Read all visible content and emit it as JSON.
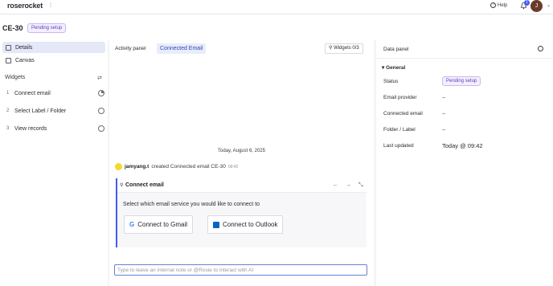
{
  "app": {
    "logo": "roserocket"
  },
  "topbar": {
    "help_label": "Help",
    "notification_count": "1",
    "avatar_initial": "J"
  },
  "header": {
    "title": "CE-30",
    "status": "Pending setup"
  },
  "sidebar": {
    "nav": [
      {
        "label": "Details",
        "icon": "list-icon",
        "active": true
      },
      {
        "label": "Canvas",
        "icon": "document-icon",
        "active": false
      }
    ],
    "widgets_heading": "Widgets",
    "widgets": [
      {
        "num": "1",
        "label": "Connect email",
        "status": "in-progress"
      },
      {
        "num": "2",
        "label": "Select Label / Folder",
        "status": "not-started"
      },
      {
        "num": "3",
        "label": "View records",
        "status": "not-started"
      }
    ]
  },
  "activity": {
    "tabs": [
      "Activity panel",
      "Connected Email"
    ],
    "widgets_button": "Widgets 0/3",
    "date_separator": "Today, August 6, 2025",
    "event": {
      "user": "jamyang.t",
      "text": "created Connected email CE-30",
      "time": "09:42"
    },
    "card": {
      "title": "Connect email",
      "prompt": "Select which email service you would like to connect to",
      "gmail_button": "Connect to Gmail",
      "outlook_button": "Connect to Outlook"
    },
    "input_placeholder": "Type to leave an internal note or @Rosie to interact with AI"
  },
  "datapanel": {
    "title": "Data panel",
    "section": "General",
    "fields": [
      {
        "label": "Status",
        "value": "Pending setup"
      },
      {
        "label": "Email provider",
        "value": "--"
      },
      {
        "label": "Connected email",
        "value": "--"
      },
      {
        "label": "Folder / Label",
        "value": "--"
      },
      {
        "label": "Last updated",
        "value": "Today @ 09:42"
      }
    ]
  },
  "colors": {
    "accent": "#3d5afe",
    "pending_bg": "#f4efff",
    "pending_text": "#5b3bbf"
  }
}
